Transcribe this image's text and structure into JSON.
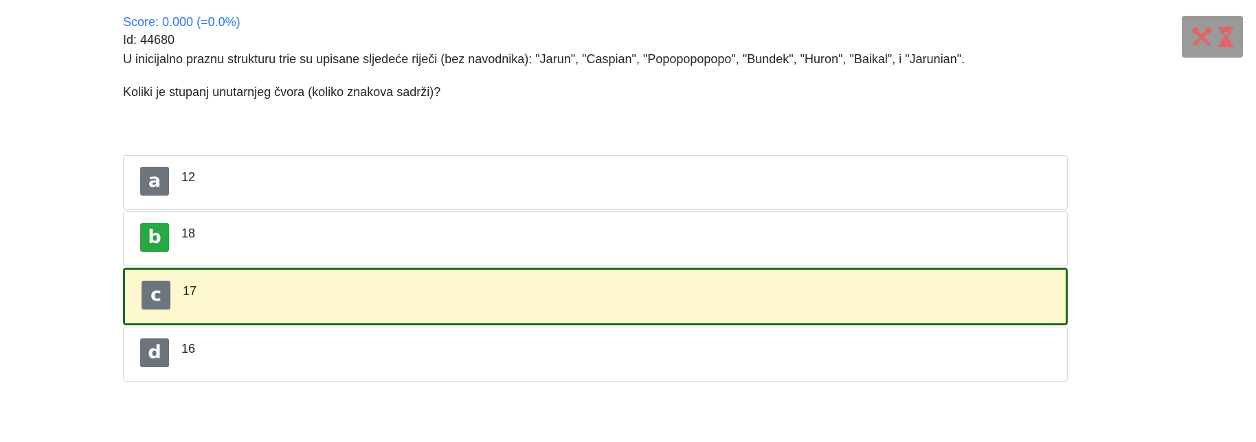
{
  "question": {
    "score": "Score: 0.000 (=0.0%)",
    "id": "Id: 44680",
    "text": "U inicijalno praznu strukturu trie su upisane sljedeće riječi (bez navodnika): \"Jarun\", \"Caspian\", \"Popopopopopo\", \"Bundek\", \"Huron\", \"Baikal\", i \"Jarunian\".",
    "prompt": "Koliki je stupanj unutarnjeg čvora (koliko znakova sadrži)?"
  },
  "answers": [
    {
      "letter": "a",
      "text": "12"
    },
    {
      "letter": "b",
      "text": "18"
    },
    {
      "letter": "c",
      "text": "17"
    },
    {
      "letter": "d",
      "text": "16"
    }
  ],
  "toolbar": {
    "icons": [
      "tools-icon",
      "hourglass-icon"
    ]
  },
  "colors": {
    "score": "#2c7be5",
    "letter_default": "#6c757d",
    "letter_correct": "#28a745",
    "selected_bg": "#fdf8cd",
    "selected_border": "#1b6e1b",
    "tool_button_bg": "#9a9a9a",
    "tool_icon": "#e06666"
  }
}
